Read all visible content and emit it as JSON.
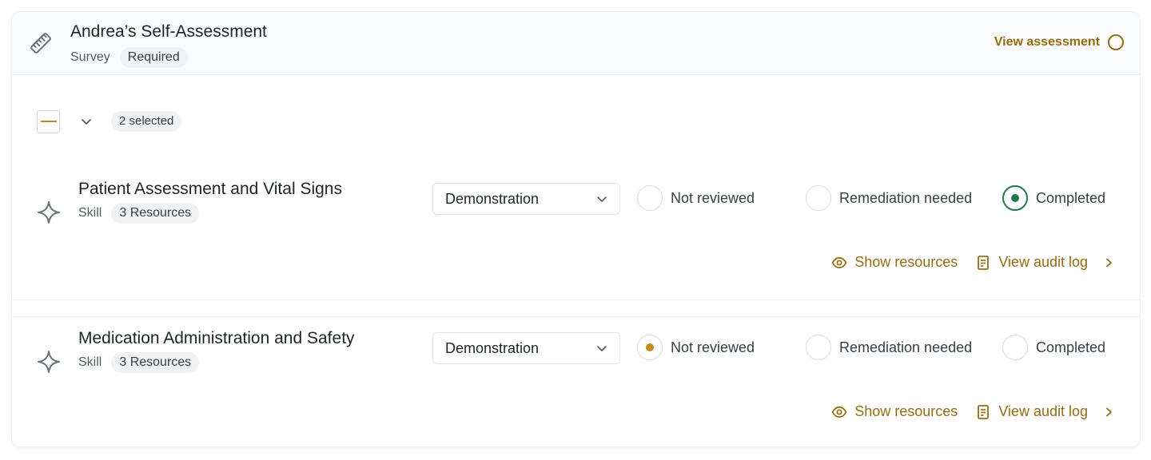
{
  "header": {
    "title": "Andrea’s Self-Assessment",
    "type_label": "Survey",
    "badge": "Required",
    "view_assessment": "View assessment",
    "icon": "ruler-icon"
  },
  "toolbar": {
    "selected_count": "2 selected"
  },
  "skills": [
    {
      "title": "Patient Assessment and Vital Signs",
      "kind": "Skill",
      "resources_badge": "3 Resources",
      "method": "Demonstration",
      "status_options": [
        "Not reviewed",
        "Remediation needed",
        "Completed"
      ],
      "selected_status": "Completed",
      "show_resources": "Show resources",
      "view_audit_log": "View audit log"
    },
    {
      "title": "Medication Administration and Safety",
      "kind": "Skill",
      "resources_badge": "3 Resources",
      "method": "Demonstration",
      "status_options": [
        "Not reviewed",
        "Remediation needed",
        "Completed"
      ],
      "selected_status": "Not reviewed",
      "show_resources": "Show resources",
      "view_audit_log": "View audit log"
    }
  ],
  "colors": {
    "accent_gold": "#9a6b08",
    "indicator_gold": "#c58a10",
    "success_green": "#1c7a4e"
  }
}
